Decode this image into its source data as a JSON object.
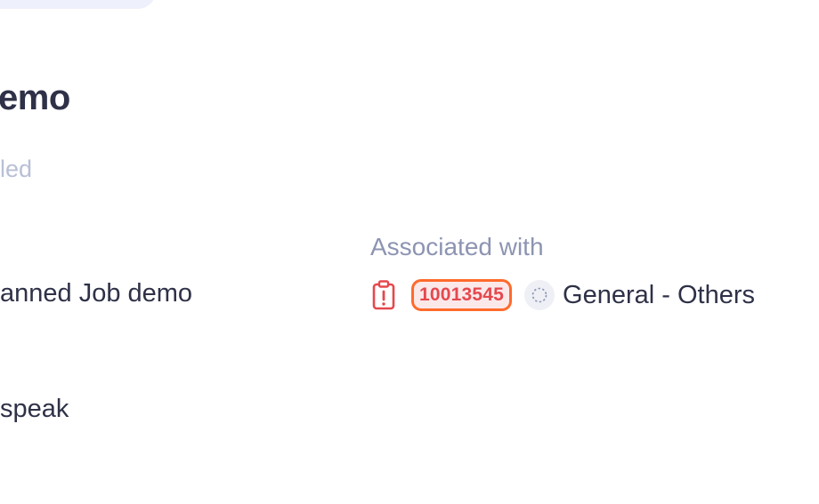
{
  "job": {
    "title": "emo",
    "status": "led",
    "name": "anned Job demo",
    "language": "speak"
  },
  "association": {
    "label": "Associated with",
    "job_id": "10013545",
    "category": "General - Others"
  },
  "icons": {
    "job_type": "clipboard-alert-icon",
    "category": "dashed-circle-icon"
  },
  "colors": {
    "accent_orange": "#ff6b2c",
    "alert_red": "#e5484d",
    "badge_bg": "#fbe9ea",
    "muted_text": "#8d94b2",
    "faded_text": "#b9bfd6",
    "pill_bg": "#eef0fb"
  }
}
